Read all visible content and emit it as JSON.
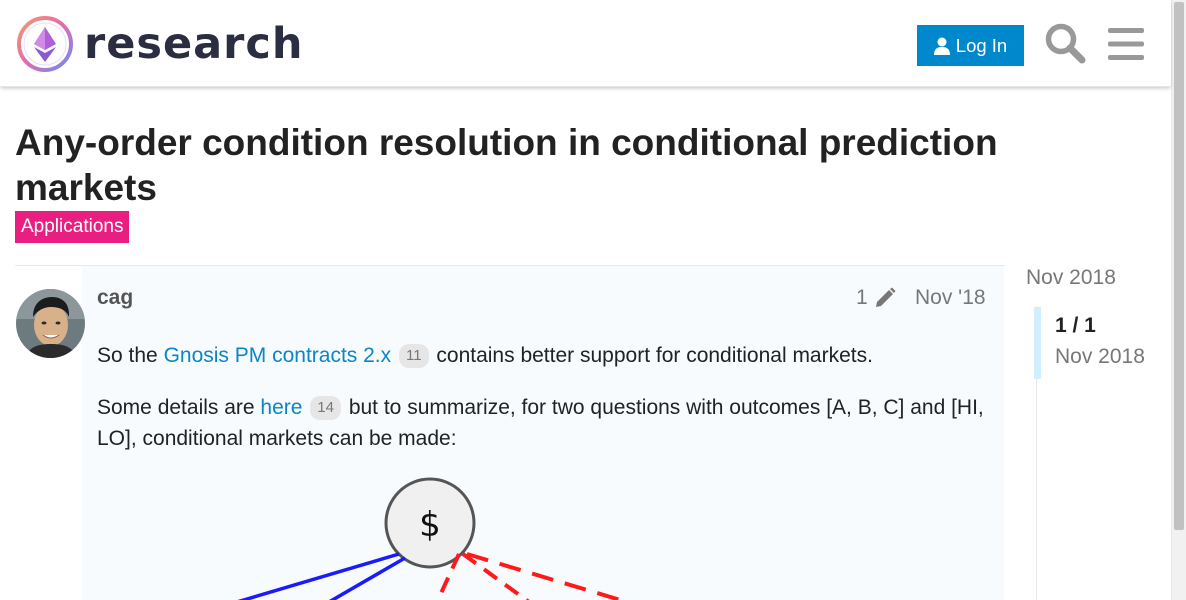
{
  "header": {
    "site_name": "research",
    "login_label": "Log In"
  },
  "topic": {
    "title": "Any-order condition resolution in conditional prediction markets",
    "category": "Applications"
  },
  "post": {
    "username": "cag",
    "edit_count": "1",
    "date": "Nov '18",
    "p1": {
      "before": "So the ",
      "link": "Gnosis PM contracts 2.x",
      "clicks": "11",
      "after": " contains better support for conditional markets."
    },
    "p2": {
      "before": "Some details are ",
      "link": "here",
      "clicks": "14",
      "after": " but to summarize, for two questions with outcomes [A, B, C] and [HI, LO], conditional markets can be made:"
    },
    "diagram": {
      "root_label": "$"
    }
  },
  "timeline": {
    "start_date": "Nov 2018",
    "position": "1 / 1",
    "position_date": "Nov 2018"
  },
  "colors": {
    "brand": "#0088cc",
    "category": "#e81f81",
    "link": "#0a86c7",
    "blue_edge": "#1a1aff",
    "red_edge": "#ff1a1a"
  },
  "icons": [
    "research-logo-icon",
    "user-icon",
    "search-icon",
    "hamburger-menu-icon",
    "pencil-icon"
  ]
}
